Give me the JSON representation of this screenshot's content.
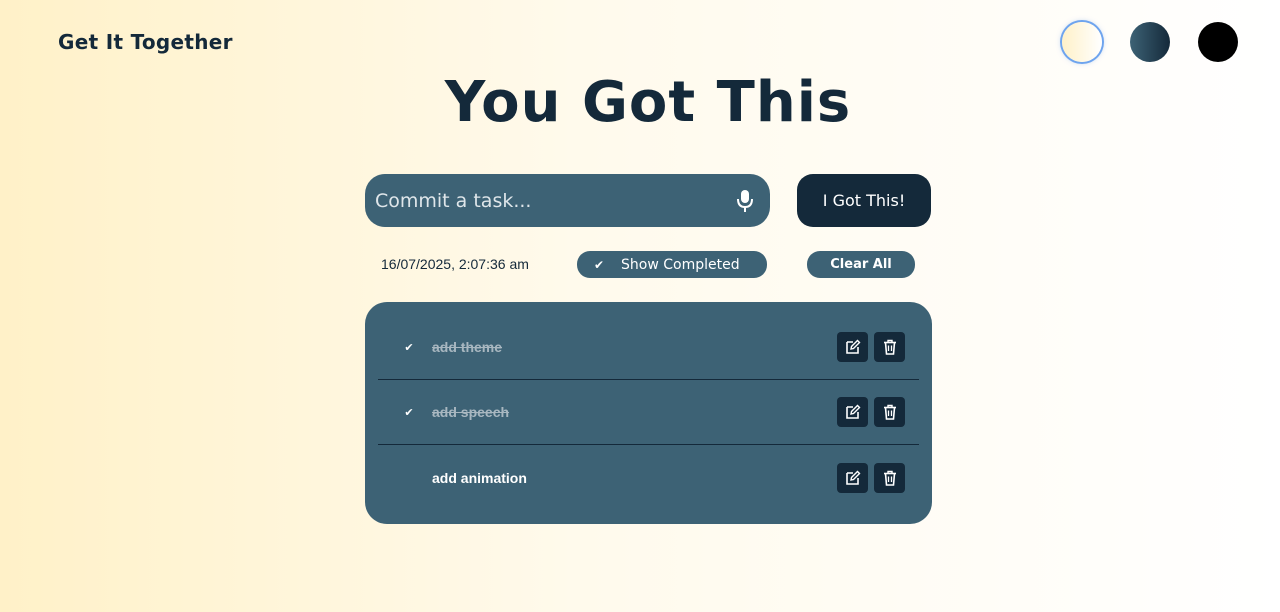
{
  "app": {
    "title": "Get It Together"
  },
  "themes": [
    {
      "name": "light",
      "selected": true
    },
    {
      "name": "dark",
      "selected": false
    },
    {
      "name": "black",
      "selected": false
    }
  ],
  "headline": "You Got This",
  "task_input": {
    "placeholder": "Commit a task...",
    "value": "",
    "mic_icon": "microphone-icon"
  },
  "add_button": {
    "label": "I Got This!"
  },
  "datetime": "16/07/2025, 2:07:36 am",
  "show_completed": {
    "label": "Show Completed",
    "checked": true,
    "check_glyph": "✔"
  },
  "clear_button": {
    "label": "Clear All"
  },
  "tasks": [
    {
      "text": "add theme",
      "completed": true,
      "check_glyph": "✔"
    },
    {
      "text": "add speech",
      "completed": true,
      "check_glyph": "✔"
    },
    {
      "text": "add animation",
      "completed": false,
      "check_glyph": ""
    }
  ],
  "colors": {
    "primary": "#3d6275",
    "dark": "#14293a",
    "background_start": "#fff1c8",
    "background_end": "#ffffff"
  }
}
